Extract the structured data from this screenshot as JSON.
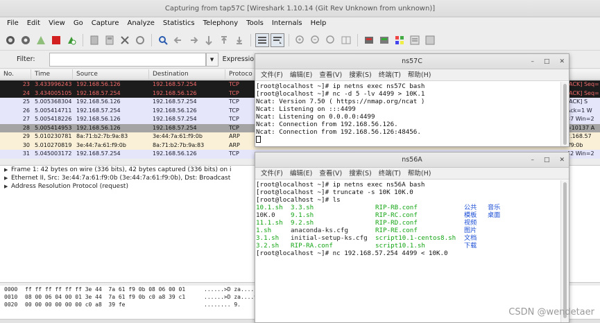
{
  "wireshark": {
    "title": "Capturing from tap57C   [Wireshark 1.10.14  (Git Rev Unknown from unknown)]",
    "menu": [
      "File",
      "Edit",
      "View",
      "Go",
      "Capture",
      "Analyze",
      "Statistics",
      "Telephony",
      "Tools",
      "Internals",
      "Help"
    ],
    "filter_label": "Filter:",
    "expression_label": "Expression...",
    "columns": {
      "no": "No.",
      "time": "Time",
      "source": "Source",
      "destination": "Destination",
      "protocol": "Protoco"
    },
    "packets": [
      {
        "no": "23",
        "time": "3.433996243",
        "src": "192.168.56.126",
        "dst": "192.168.57.254",
        "proto": "TCP",
        "info": "[ACK] Seq=",
        "bg": "#1c1c1c",
        "fg": "#f36a6a"
      },
      {
        "no": "24",
        "time": "3.434005105",
        "src": "192.168.57.254",
        "dst": "192.168.56.126",
        "proto": "TCP",
        "info": "[ACK] Seq=",
        "bg": "#1c1c1c",
        "fg": "#f36a6a"
      },
      {
        "no": "25",
        "time": "5.005368304",
        "src": "192.168.56.126",
        "dst": "192.168.57.254",
        "proto": "TCP",
        "info": "[ACK] S",
        "bg": "#e6e6fb",
        "fg": "#1a1a2a"
      },
      {
        "no": "26",
        "time": "5.005414711",
        "src": "192.168.57.254",
        "dst": "192.168.56.126",
        "proto": "TCP",
        "info": "Ack=1 W",
        "bg": "#e6e6fb",
        "fg": "#1a1a2a"
      },
      {
        "no": "27",
        "time": "5.005418226",
        "src": "192.168.56.126",
        "dst": "192.168.57.254",
        "proto": "TCP",
        "info": "37 Win=2",
        "bg": "#e6e6fb",
        "fg": "#1a1a2a"
      },
      {
        "no": "28",
        "time": "5.005414953",
        "src": "192.168.56.126",
        "dst": "192.168.57.254",
        "proto": "TCP",
        "info": "=10137 A",
        "bg": "#a4a4a4",
        "fg": "#111"
      },
      {
        "no": "29",
        "time": "5.010230781",
        "src": "8a:71:b2:7b:9a:83",
        "dst": "3e:44:7a:61:f9:0b",
        "proto": "ARP",
        "info": "2.168.57",
        "bg": "#faf0d7",
        "fg": "#111"
      },
      {
        "no": "30",
        "time": "5.010270819",
        "src": "3e:44:7a:61:f9:0b",
        "dst": "8a:71:b2:7b:9a:83",
        "proto": "ARP",
        "info": ":f9:0b",
        "bg": "#faf0d7",
        "fg": "#111"
      },
      {
        "no": "31",
        "time": "5.045003172",
        "src": "192.168.57.254",
        "dst": "192.168.56.126",
        "proto": "TCP",
        "info": "42 Win=2",
        "bg": "#e6e6fb",
        "fg": "#1a1a2a"
      }
    ],
    "details": [
      "Frame 1: 42 bytes on wire (336 bits), 42 bytes captured (336 bits) on i",
      "Ethernet II, Src: 3e:44:7a:61:f9:0b (3e:44:7a:61:f9:0b), Dst: Broadcast",
      "Address Resolution Protocol (request)"
    ],
    "bytes": [
      {
        "offset": "0000",
        "hex": "ff ff ff ff ff ff 3e 44  7a 61 f9 0b 08 06 00 01",
        "ascii": "......>D za...."
      },
      {
        "offset": "0010",
        "hex": "08 00 06 04 00 01 3e 44  7a 61 f9 0b c0 a8 39 c1",
        "ascii": "......>D za....9"
      },
      {
        "offset": "0020",
        "hex": "00 00 00 00 00 00 c0 a8  39 fe",
        "ascii": "........ 9."
      }
    ]
  },
  "term1": {
    "title": "ns57C",
    "menu": [
      "文件(F)",
      "编辑(E)",
      "查看(V)",
      "搜索(S)",
      "终端(T)",
      "帮助(H)"
    ],
    "lines": [
      "[root@localhost ~]# ip netns exec ns57C bash",
      "[root@localhost ~]# nc -d 5 -lv 4499 > 10K.1",
      "Ncat: Version 7.50 ( https://nmap.org/ncat )",
      "Ncat: Listening on :::4499",
      "Ncat: Listening on 0.0.0.0:4499",
      "Ncat: Connection from 192.168.56.126.",
      "Ncat: Connection from 192.168.56.126:48456."
    ]
  },
  "term2": {
    "title": "ns56A",
    "menu": [
      "文件(F)",
      "编辑(E)",
      "查看(V)",
      "搜索(S)",
      "终端(T)",
      "帮助(H)"
    ],
    "lines_top": [
      "[root@localhost ~]# ip netns exec ns56A bash",
      "[root@localhost ~]# truncate -s 10K 10K.0",
      "[root@localhost ~]# ls"
    ],
    "ls_col1": [
      "10.1.sh",
      "10K.0",
      "11.1.sh",
      "1.sh",
      "3.1.sh",
      "3.2.sh"
    ],
    "ls_col2": [
      "3.3.sh",
      "9.1.sh",
      "9.2.sh",
      "anaconda-ks.cfg",
      "initial-setup-ks.cfg",
      "RIP-RA.conf"
    ],
    "ls_col3": [
      "RIP-RB.conf",
      "RIP-RC.conf",
      "RIP-RD.conf",
      "RIP-RE.conf",
      "script10.1-centos8.sh",
      "script10.1.sh"
    ],
    "ls_col4": [
      "公共",
      "模板",
      "视频",
      "图片",
      "文档",
      "下载"
    ],
    "ls_col5": [
      "音乐",
      "桌面"
    ],
    "last_line": "[root@localhost ~]# nc 192.168.57.254 4499 < 10K.0"
  },
  "watermark": "CSDN @wendetaer",
  "colors": {
    "green": "#11a411",
    "blue": "#1c4fd6"
  }
}
